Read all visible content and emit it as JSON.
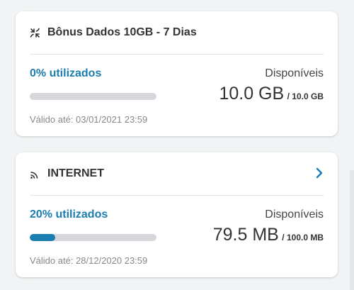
{
  "colors": {
    "accent": "#1b7db0",
    "track": "#d5d7da",
    "background": "#f1f3f4"
  },
  "cards": [
    {
      "icon": "data-transfer-icon",
      "title": "Bônus Dados 10GB - 7 Dias",
      "has_chevron": false,
      "used_label": "0% utilizados",
      "used_fraction": 0.0,
      "available_label": "Disponíveis",
      "available_amount": "10.0 GB",
      "total_amount": "/ 10.0 GB",
      "valid_until": "Válido até: 03/01/2021 23:59"
    },
    {
      "icon": "wifi-signal-icon",
      "title": "INTERNET",
      "has_chevron": true,
      "chevron_icon": "chevron-right-icon",
      "used_label": "20% utilizados",
      "used_fraction": 0.2,
      "available_label": "Disponíveis",
      "available_amount": "79.5 MB",
      "total_amount": "/ 100.0 MB",
      "valid_until": "Válido até: 28/12/2020 23:59"
    }
  ]
}
